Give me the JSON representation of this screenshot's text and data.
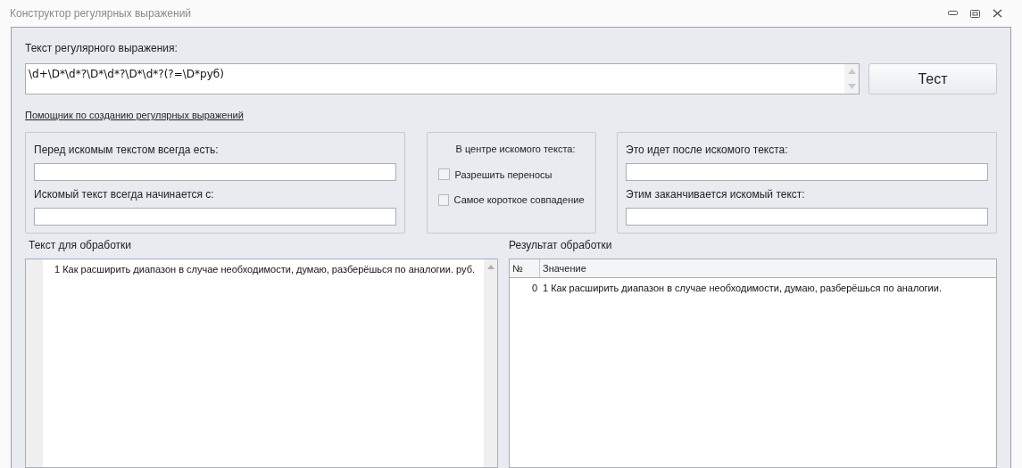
{
  "window": {
    "title": "Конструктор регулярных выражений"
  },
  "regex": {
    "label": "Текст регулярного выражения:",
    "value": "\\d+\\D*\\d*?\\D*\\d*?\\D*\\d*?(?=\\D*руб)"
  },
  "test_button": "Тест",
  "helper_link": "Помощник по созданию регулярных выражений",
  "before_group": {
    "fields": [
      {
        "label": "Перед искомым текстом всегда есть:"
      },
      {
        "label": "Искомый текст всегда начинается с:"
      }
    ]
  },
  "center_group": {
    "title": "В центре искомого текста:",
    "options": [
      {
        "label": "Разрешить переносы",
        "checked": false
      },
      {
        "label": "Самое короткое совпадение",
        "checked": false
      }
    ]
  },
  "after_group": {
    "fields": [
      {
        "label": "Это идет после искомого текста:"
      },
      {
        "label": "Этим заканчивается искомый текст:"
      }
    ]
  },
  "input_text": {
    "label": "Текст для обработки",
    "value": "1 Как расширить диапазон в случае необходимости, думаю, разберёшься по аналогии. руб."
  },
  "result": {
    "label": "Результат обработки",
    "columns": [
      "№",
      "Значение"
    ],
    "rows": [
      [
        "0",
        "1 Как расширить диапазон в случае необходимости, думаю, разберёшься по аналогии."
      ]
    ]
  }
}
